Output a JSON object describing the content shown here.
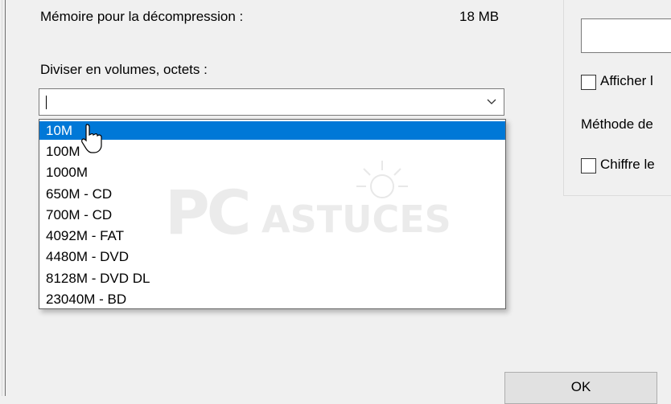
{
  "dialog": {
    "memory_label": "Mémoire pour la décompression :",
    "memory_value": "18 MB",
    "split_label": "Diviser en volumes, octets :",
    "split_combo": {
      "value": "",
      "options": [
        "10M",
        "100M",
        "1000M",
        "650M - CD",
        "700M - CD",
        "4092M - FAT",
        "4480M - DVD",
        "8128M - DVD DL",
        "23040M - BD"
      ],
      "highlighted": "10M"
    },
    "right_panel": {
      "show_label": "Afficher l",
      "method_label": "Méthode de",
      "encrypt_label": "Chiffre le"
    },
    "ok_label": "OK"
  },
  "watermark": {
    "part1": "PC",
    "part2": "ASTUCES"
  },
  "colors": {
    "selection": "#0078d7",
    "background": "#f0f0f0"
  }
}
